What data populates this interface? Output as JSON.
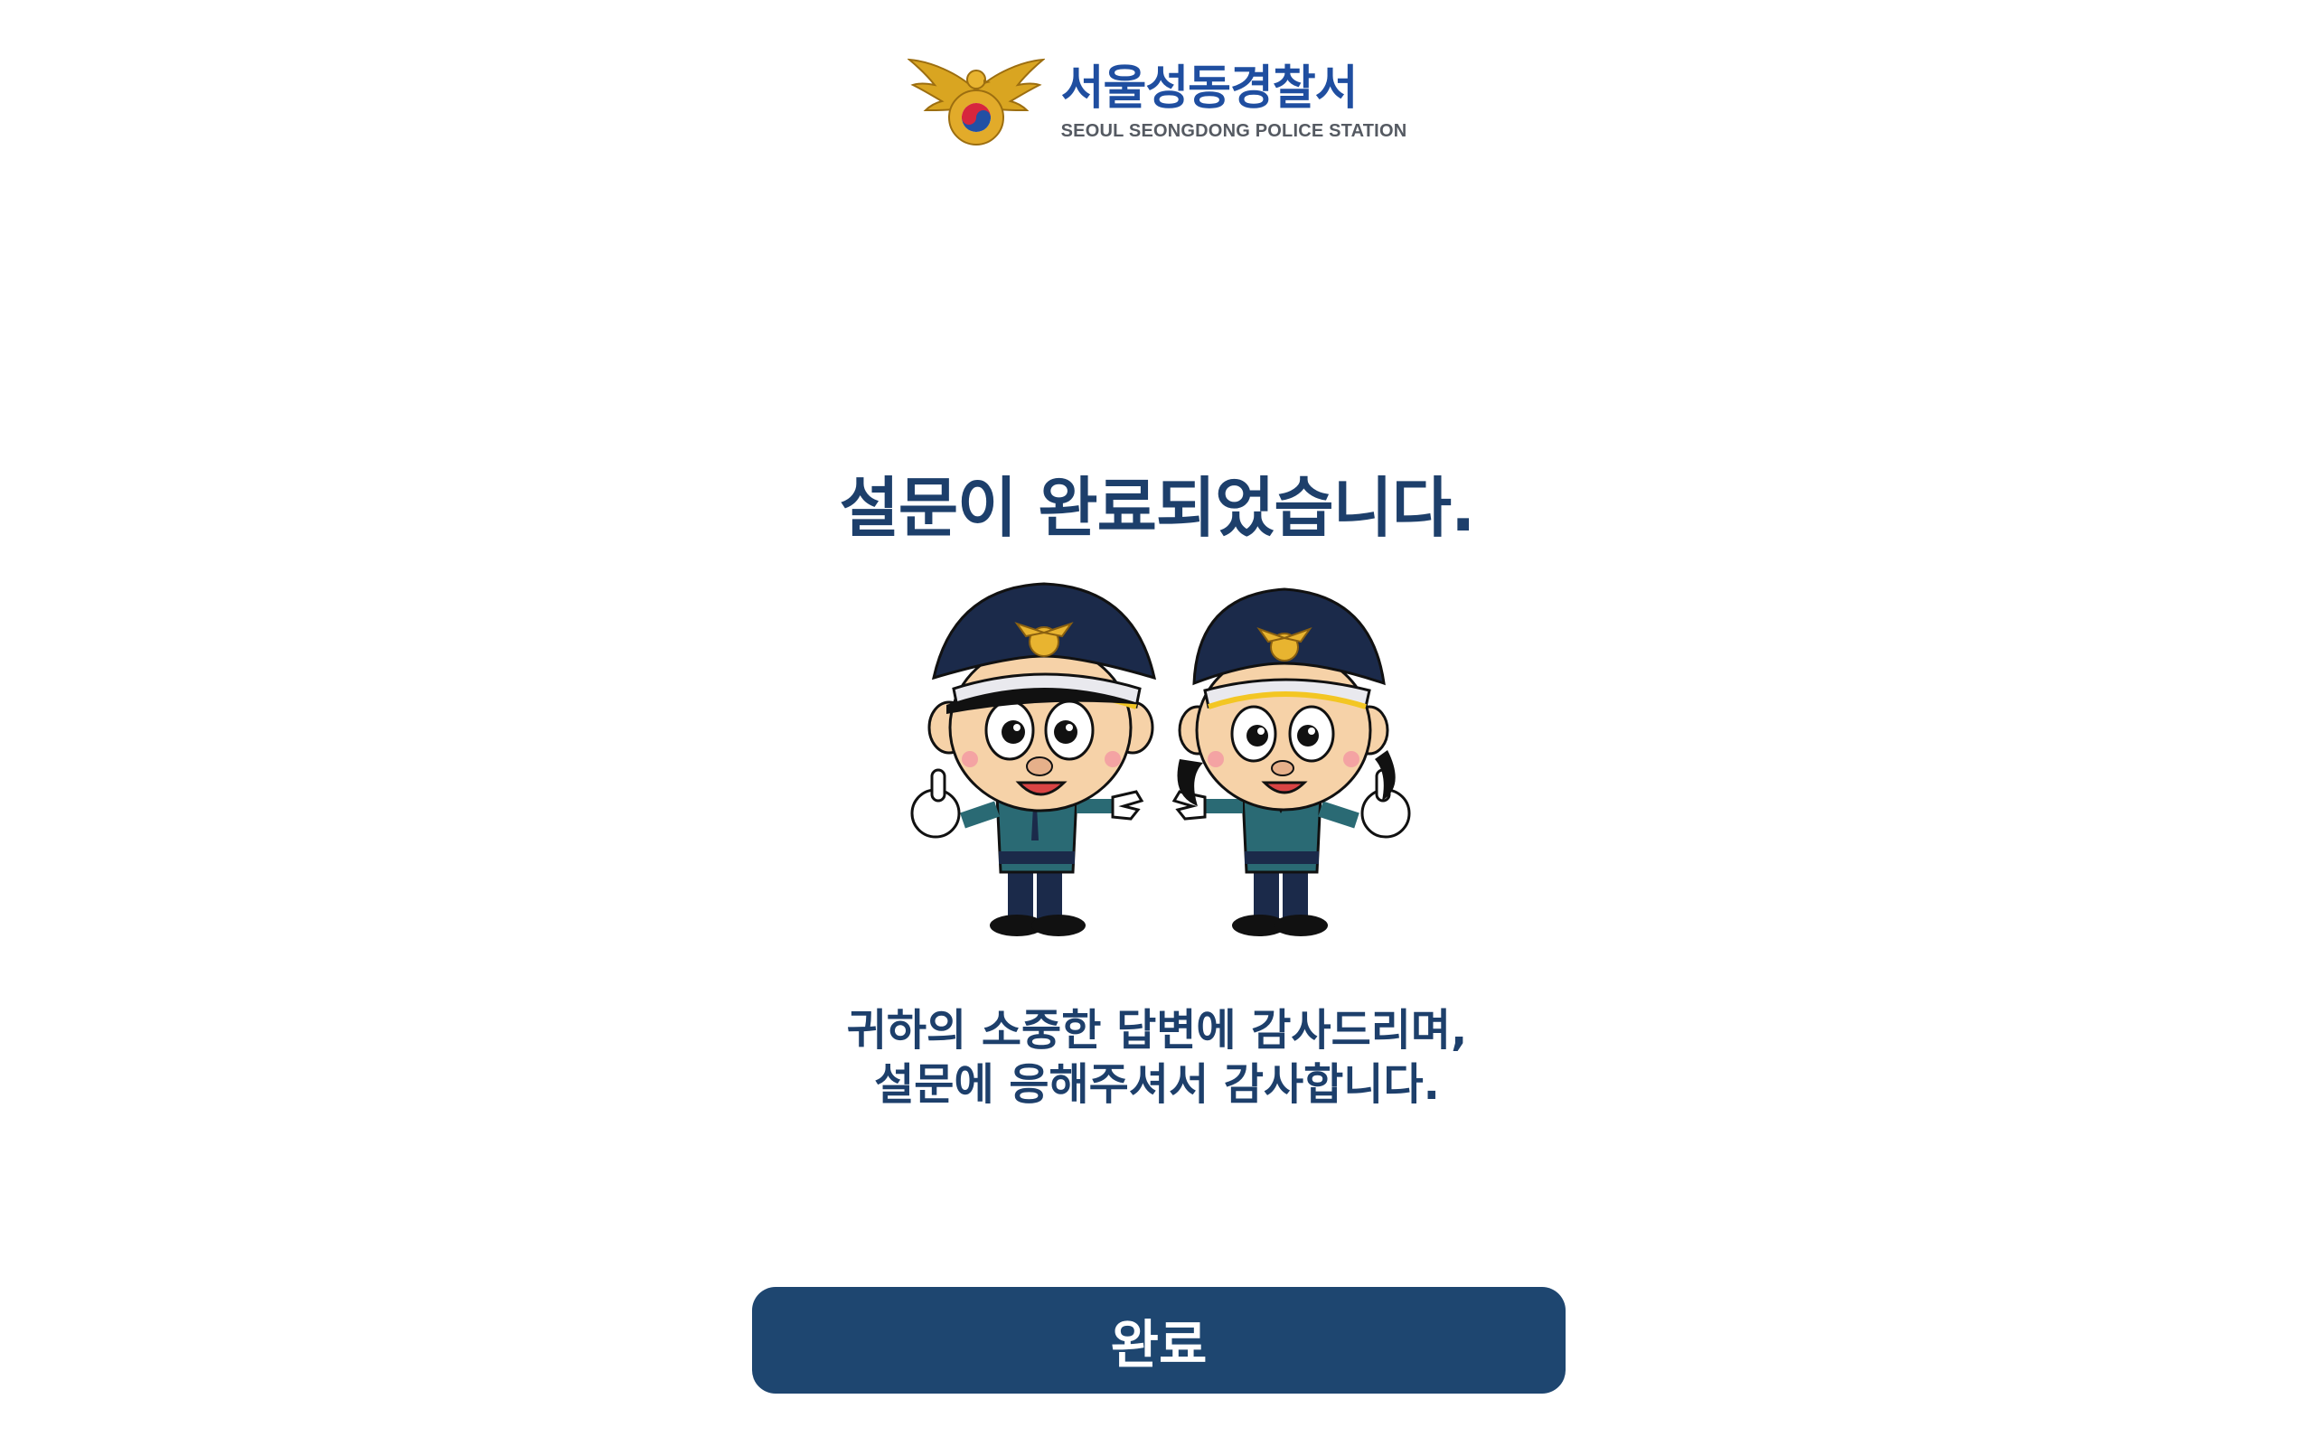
{
  "header": {
    "logo_name_ko": "서울성동경찰서",
    "logo_name_en": "SEOUL SEONGDONG POLICE STATION",
    "emblem_icon": "police-eagle-emblem-icon"
  },
  "main": {
    "title": "설문이 완료되었습니다.",
    "mascot_image": "police-mascots-illustration",
    "message_line1": "귀하의 소중한 답변에 감사드리며,",
    "message_line2": "설문에 응해주셔서 감사합니다."
  },
  "actions": {
    "complete_label": "완료"
  },
  "colors": {
    "primary": "#1e4670",
    "title_text": "#1d3f6b",
    "logo_blue": "#1f4ea0",
    "gold": "#d9a521"
  }
}
